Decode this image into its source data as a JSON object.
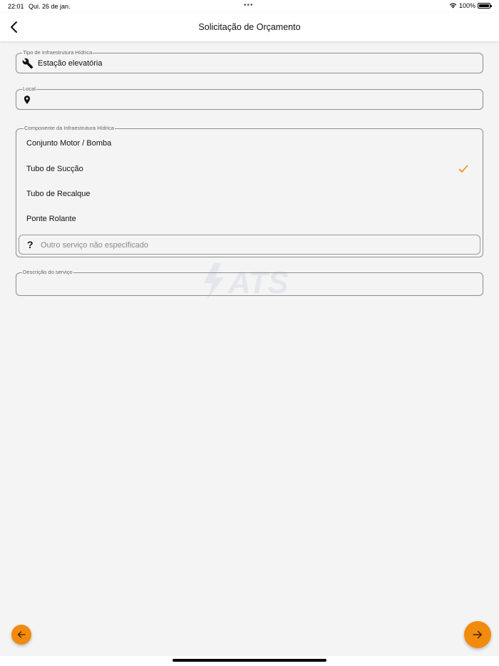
{
  "status_bar": {
    "time": "22:01",
    "date": "Qui. 26 de jan.",
    "dots": "•••",
    "battery": "100%"
  },
  "nav": {
    "title": "Solicitação de Orçamento",
    "back_icon": "chevron-left-icon"
  },
  "form": {
    "tipo": {
      "label": "Tipo de Infraestrutura Hídrica",
      "value": "Estação elevatória",
      "icon": "wrench-icon"
    },
    "local": {
      "label": "Local",
      "value": "",
      "icon": "map-pin-icon"
    },
    "componente": {
      "label": "Componente da Infraestrutura Hídrica",
      "options": [
        {
          "label": "Conjunto Motor / Bomba",
          "selected": false
        },
        {
          "label": "Tubo de Sucção",
          "selected": true
        },
        {
          "label": "Tubo de Recalque",
          "selected": false
        },
        {
          "label": "Ponte Rolante",
          "selected": false
        }
      ],
      "other_placeholder": "Outro serviço não especificado",
      "other_icon": "question-mark-icon"
    },
    "descricao": {
      "label": "Descrição do serviço",
      "value": ""
    }
  },
  "watermark": "ATS",
  "colors": {
    "accent": "#f28a0d",
    "background": "#f4f4f4"
  }
}
